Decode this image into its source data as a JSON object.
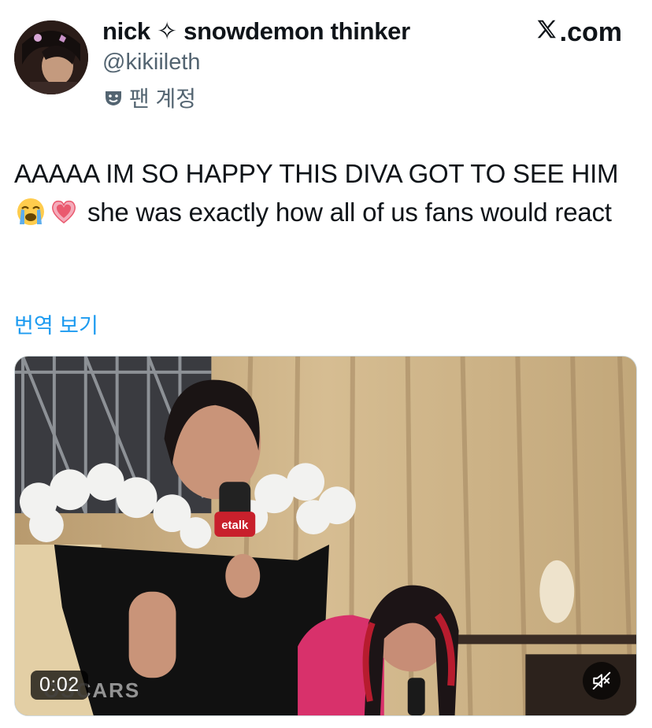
{
  "author": {
    "display_name": "nick ✧ snowdemon thinker",
    "handle": "@kikiileth",
    "badge_label": "팬 계정",
    "badge_icon": "theater-mask-icon",
    "avatar_icon": "profile-avatar"
  },
  "brand": {
    "label": ".com",
    "icon": "x-logo-icon"
  },
  "tweet": {
    "text_part1": "AAAAA IM SO HAPPY THIS DIVA GOT TO SEE HIM",
    "emojis": [
      "loudly-crying-face-emoji",
      "growing-heart-emoji"
    ],
    "text_part2": " she was exactly how all of us fans would react",
    "translate_label": "번역 보기"
  },
  "media": {
    "type": "video",
    "duration": "0:02",
    "watermark": "OSCARS",
    "mic_flag_label": "etalk",
    "mute_icon": "muted-speaker-icon"
  },
  "colors": {
    "link": "#1d9bf0",
    "secondary_text": "#536471",
    "primary_text": "#0f1419"
  }
}
